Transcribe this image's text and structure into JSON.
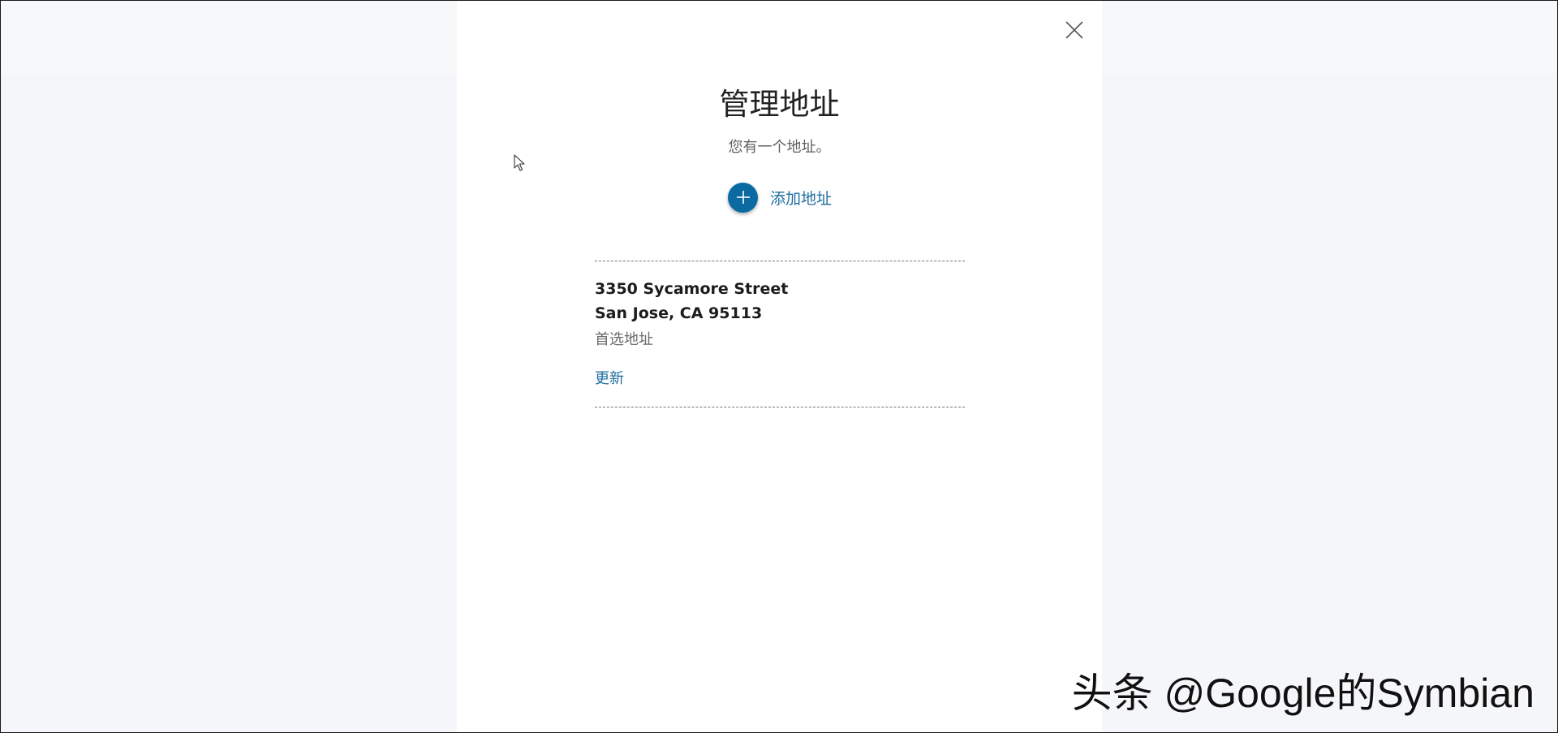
{
  "dialog": {
    "title": "管理地址",
    "subtitle": "您有一个地址。",
    "add_address_label": "添加地址",
    "close_icon": "close-icon",
    "add_icon": "plus-icon"
  },
  "address": {
    "line1": "3350 Sycamore Street",
    "line2": "San Jose, CA 95113",
    "preferred_label": "首选地址",
    "update_label": "更新"
  },
  "colors": {
    "accent": "#0b6aa2",
    "link": "#1f6d9e",
    "background": "#f4f6f9",
    "dialog_background": "#ffffff"
  },
  "watermark": {
    "text": "头条 @Google的Symbian"
  }
}
